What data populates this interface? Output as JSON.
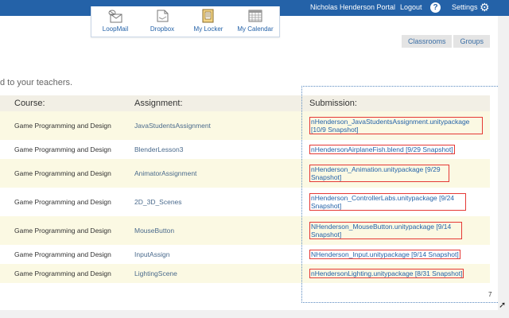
{
  "topbar": {
    "portal_label": "Nicholas Henderson Portal",
    "logout_label": "Logout",
    "help_icon": "help-circle-icon",
    "settings_label": "Settings",
    "settings_icon": "gear-icon"
  },
  "tools": [
    {
      "label": "LoopMail",
      "icon": "loopmail-icon"
    },
    {
      "label": "Dropbox",
      "icon": "dropbox-icon"
    },
    {
      "label": "My Locker",
      "icon": "locker-icon"
    },
    {
      "label": "My Calendar",
      "icon": "calendar-icon"
    }
  ],
  "tabs": [
    "Classrooms",
    "Groups"
  ],
  "note": "d to your teachers.",
  "table": {
    "headers": [
      "Course:",
      "Assignment:",
      "Submission:"
    ],
    "rows": [
      {
        "course": "Game Programming and Design",
        "assignment": "JavaStudentsAssignment",
        "submission": "nHenderson_JavaStudentsAssignment.unitypackage [10/9 Snapshot]"
      },
      {
        "course": "Game Programming and Design",
        "assignment": "BlenderLesson3",
        "submission": "nHendersonAirplaneFish.blend [9/29 Snapshot]"
      },
      {
        "course": "Game Programming and Design",
        "assignment": "AnimatorAssignment",
        "submission": "nHenderson_Animation.unitypackage [9/29 Snapshot]"
      },
      {
        "course": "Game Programming and Design",
        "assignment": "2D_3D_Scenes",
        "submission": "nHenderson_ControllerLabs.unitypackage [9/24 Snapshot]"
      },
      {
        "course": "Game Programming and Design",
        "assignment": "MouseButton",
        "submission": "NHenderson_MouseButton.unitypackage [9/14 Snapshot]"
      },
      {
        "course": "Game Programming and Design",
        "assignment": "InputAssign",
        "submission": "NHenderson_Input.unitypackage [9/14 Snapshot]"
      },
      {
        "course": "Game Programming and Design",
        "assignment": "LightingScene",
        "submission": "nHendersonLighting.unitypackage [8/31 Snapshot]"
      }
    ]
  },
  "page_number": "7",
  "colors": {
    "topbar": "#2462a8",
    "row_alt": "#fbf9e3",
    "header_bg": "#f2efe5",
    "submission_border": "#e53935"
  }
}
